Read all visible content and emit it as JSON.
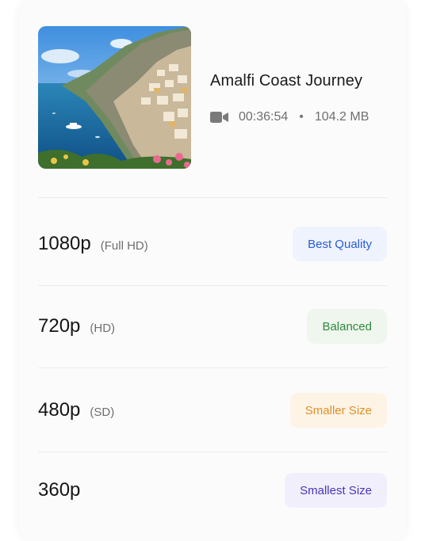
{
  "video": {
    "title": "Amalfi Coast Journey",
    "duration": "00:36:54",
    "separator": "•",
    "size": "104.2 MB",
    "icon": "video-camera-icon"
  },
  "options": [
    {
      "resolution": "1080p",
      "label": "(Full HD)",
      "badge": "Best Quality",
      "badge_bg": "#eef3fd",
      "badge_color": "#2a5bd7"
    },
    {
      "resolution": "720p",
      "label": "(HD)",
      "badge": "Balanced",
      "badge_bg": "#eef6ee",
      "badge_color": "#2f8a3b"
    },
    {
      "resolution": "480p",
      "label": "(SD)",
      "badge": "Smaller Size",
      "badge_bg": "#fdf4e6",
      "badge_color": "#e0902a"
    },
    {
      "resolution": "360p",
      "label": "",
      "badge": "Smallest Size",
      "badge_bg": "#f1effb",
      "badge_color": "#4a35b8"
    }
  ]
}
